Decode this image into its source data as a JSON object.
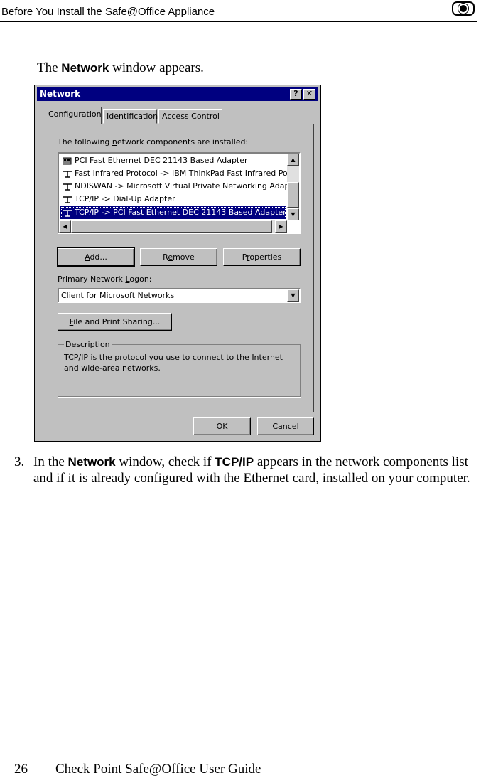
{
  "header": {
    "title": "Before You Install the Safe@Office Appliance",
    "logo_icon": "checkpoint-logo-icon"
  },
  "intro": {
    "before": "The ",
    "bold": "Network",
    "after": " window appears."
  },
  "dialog": {
    "title": "Network",
    "help_button": "?",
    "close_button": "✕",
    "tabs": [
      "Configuration",
      "Identification",
      "Access Control"
    ],
    "list_label_pre": "The following ",
    "list_label_u": "n",
    "list_label_post": "etwork components are installed:",
    "components": [
      {
        "label": "PCI Fast Ethernet DEC 21143 Based Adapter",
        "icon": "network-adapter-icon"
      },
      {
        "label": "Fast Infrared Protocol -> IBM ThinkPad Fast Infrared Port",
        "icon": "protocol-icon"
      },
      {
        "label": "NDISWAN -> Microsoft Virtual Private Networking Adapter",
        "icon": "protocol-icon"
      },
      {
        "label": "TCP/IP -> Dial-Up Adapter",
        "icon": "protocol-icon"
      },
      {
        "label": "TCP/IP -> PCI Fast Ethernet DEC 21143 Based Adapter",
        "icon": "protocol-icon"
      }
    ],
    "selected_index": 4,
    "add_u": "A",
    "add_rest": "dd...",
    "remove_pre": "R",
    "remove_u": "e",
    "remove_rest": "move",
    "properties_pre": "P",
    "properties_u": "r",
    "properties_rest": "operties",
    "logon_pre": "Primary Network ",
    "logon_u": "L",
    "logon_rest": "ogon:",
    "logon_value": "Client for Microsoft Networks",
    "file_u": "F",
    "file_rest": "ile and Print Sharing...",
    "description_label": "Description",
    "description_text": "TCP/IP is the protocol you use to connect to the Internet and wide-area networks.",
    "ok": "OK",
    "cancel": "Cancel"
  },
  "step": {
    "number": "3.",
    "t1": "In the ",
    "b1": "Network",
    "t2": " window, check if ",
    "b2": "TCP/IP",
    "t3": " appears in the network components list and if it is already configured with the Ethernet card, installed on your computer."
  },
  "footer": {
    "page": "26",
    "title": "Check Point Safe@Office User Guide"
  }
}
